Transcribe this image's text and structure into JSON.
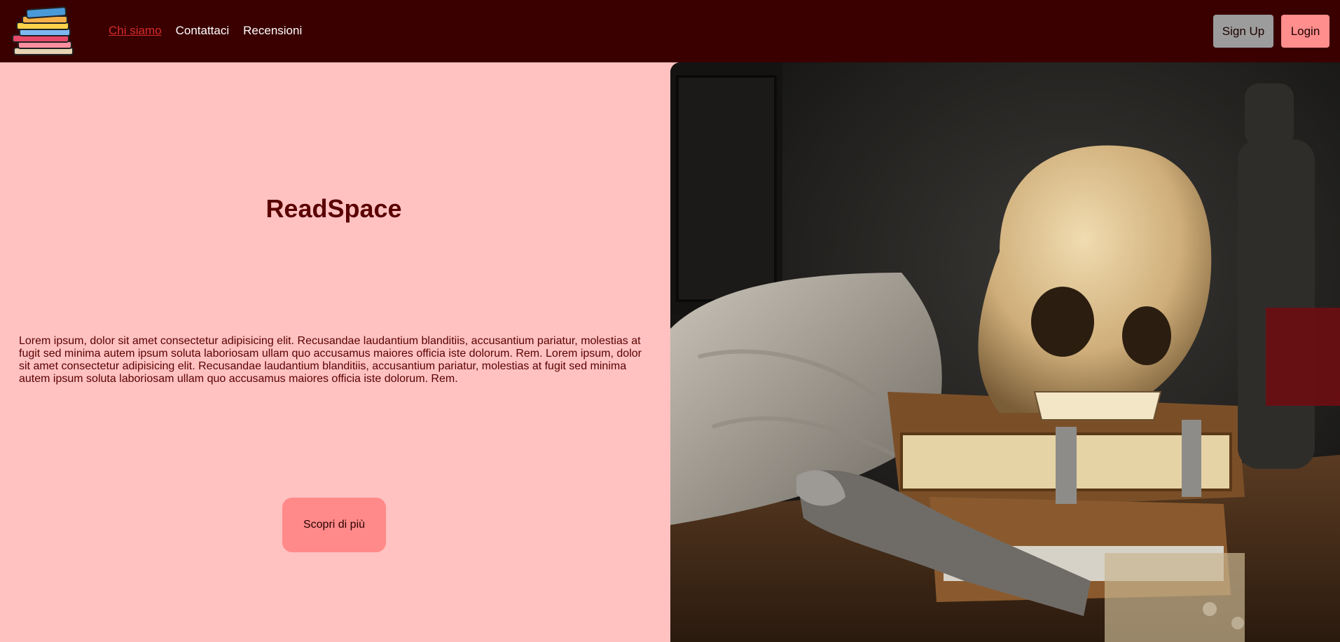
{
  "brand": {
    "logo_icon": "stacked-books-logo-icon"
  },
  "nav": {
    "links": [
      {
        "label": "Chi siamo",
        "active": true
      },
      {
        "label": "Contattaci",
        "active": false
      },
      {
        "label": "Recensioni",
        "active": false
      }
    ],
    "signup_label": "Sign Up",
    "login_label": "Login"
  },
  "hero": {
    "title": "ReadSpace",
    "body": "Lorem ipsum, dolor sit amet consectetur adipisicing elit. Recusandae laudantium blanditiis, accusantium pariatur, molestias at fugit sed minima autem ipsum soluta laboriosam ullam quo accusamus maiores officia iste dolorum. Rem. Lorem ipsum, dolor sit amet consectetur adipisicing elit. Recusandae laudantium blanditiis, accusantium pariatur, molestias at fugit sed minima autem ipsum soluta laboriosam ullam quo accusamus maiores officia iste dolorum. Rem.",
    "cta_label": "Scopri di più",
    "image_icon": "skull-books-still-life-image"
  },
  "colors": {
    "navbar": "#3a0000",
    "panel": "#ffc2c1",
    "title": "#5a0101",
    "signup_bg": "#9c9c9c",
    "login_bg": "#ff8e8d",
    "cta_bg": "#ff8a89",
    "active_link": "#d62a2a"
  }
}
